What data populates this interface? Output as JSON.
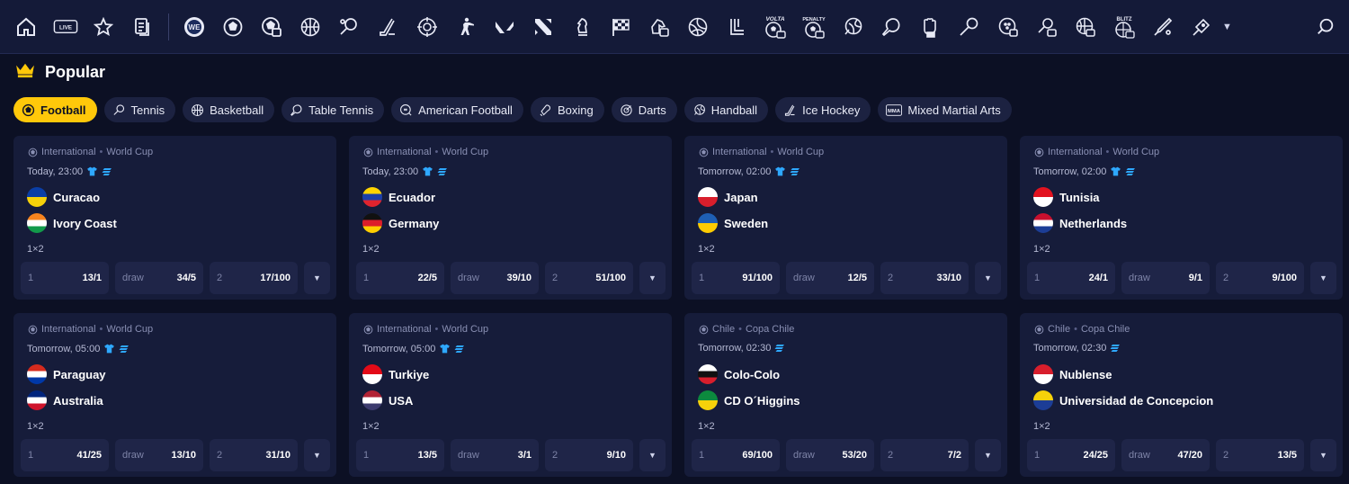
{
  "nav": {
    "icons": [
      "home-icon",
      "live-icon",
      "star-icon",
      "betslip-icon",
      "e-soccer-icon",
      "football-icon",
      "virtual-football-icon",
      "basketball-icon",
      "tennis-icon",
      "ice-hockey-icon",
      "esports-target-icon",
      "counter-strike-icon",
      "valorant-icon",
      "dota-icon",
      "chess-icon",
      "racing-flag-icon",
      "horse-racing-icon",
      "volleyball-icon",
      "table-icon",
      "volta-icon",
      "penalty-icon",
      "handball-icon",
      "table-tennis-icon",
      "boxing-glove-icon",
      "badminton-icon",
      "golf-icon",
      "esports-tennis-icon",
      "e-basketball-icon",
      "blitz-icon",
      "cricket-icon",
      "darts-icon"
    ],
    "live_label": "LIVE",
    "esoccer_label": "WE",
    "volta_label": "VOLTA",
    "penalty_label": "PENALTY",
    "blitz_label": "BLITZ"
  },
  "popular": {
    "title": "Popular"
  },
  "chips": [
    {
      "label": "Football",
      "icon": "football-icon",
      "active": true
    },
    {
      "label": "Tennis",
      "icon": "tennis-icon",
      "active": false
    },
    {
      "label": "Basketball",
      "icon": "basketball-icon",
      "active": false
    },
    {
      "label": "Table Tennis",
      "icon": "table-tennis-icon",
      "active": false
    },
    {
      "label": "American Football",
      "icon": "american-football-icon",
      "active": false
    },
    {
      "label": "Boxing",
      "icon": "boxing-icon",
      "active": false
    },
    {
      "label": "Darts",
      "icon": "darts-icon",
      "active": false
    },
    {
      "label": "Handball",
      "icon": "handball-icon",
      "active": false
    },
    {
      "label": "Ice Hockey",
      "icon": "ice-hockey-icon",
      "active": false
    },
    {
      "label": "Mixed Martial Arts",
      "icon": "mma-icon",
      "active": false
    }
  ],
  "mma_badge": "MMA",
  "odds_labels": {
    "home": "1",
    "draw": "draw",
    "away": "2"
  },
  "matches": [
    {
      "country": "International",
      "league": "World Cup",
      "time": "Today, 23:00",
      "kit": true,
      "stats": true,
      "home": "Curacao",
      "away": "Ivory Coast",
      "market": "1×2",
      "odd1": "13/1",
      "oddx": "34/5",
      "odd2": "17/100",
      "home_colors": [
        "#0a3ea6",
        "#f6d10a"
      ],
      "away_colors": [
        "#f7841e",
        "#ffffff",
        "#129a4a"
      ]
    },
    {
      "country": "International",
      "league": "World Cup",
      "time": "Today, 23:00",
      "kit": true,
      "stats": true,
      "home": "Ecuador",
      "away": "Germany",
      "market": "1×2",
      "odd1": "22/5",
      "oddx": "39/10",
      "odd2": "51/100",
      "home_colors": [
        "#ffd400",
        "#1c3fa8",
        "#e0242e"
      ],
      "away_colors": [
        "#111111",
        "#dd1e2a",
        "#ffce00"
      ]
    },
    {
      "country": "International",
      "league": "World Cup",
      "time": "Tomorrow, 02:00",
      "kit": true,
      "stats": true,
      "home": "Japan",
      "away": "Sweden",
      "market": "1×2",
      "odd1": "91/100",
      "oddx": "12/5",
      "odd2": "33/10",
      "home_colors": [
        "#ffffff",
        "#d81e2c"
      ],
      "away_colors": [
        "#1e5fb4",
        "#fecc02"
      ]
    },
    {
      "country": "International",
      "league": "World Cup",
      "time": "Tomorrow, 02:00",
      "kit": true,
      "stats": true,
      "home": "Tunisia",
      "away": "Netherlands",
      "market": "1×2",
      "odd1": "24/1",
      "oddx": "9/1",
      "odd2": "9/100",
      "home_colors": [
        "#e2121f",
        "#ffffff"
      ],
      "away_colors": [
        "#c8102e",
        "#ffffff",
        "#1c3d96"
      ]
    },
    {
      "country": "International",
      "league": "World Cup",
      "time": "Tomorrow, 05:00",
      "kit": true,
      "stats": true,
      "home": "Paraguay",
      "away": "Australia",
      "market": "1×2",
      "odd1": "41/25",
      "oddx": "13/10",
      "odd2": "31/10",
      "home_colors": [
        "#d52b1e",
        "#ffffff",
        "#0038a8"
      ],
      "away_colors": [
        "#00247d",
        "#ffffff",
        "#cf142b"
      ]
    },
    {
      "country": "International",
      "league": "World Cup",
      "time": "Tomorrow, 05:00",
      "kit": true,
      "stats": true,
      "home": "Turkiye",
      "away": "USA",
      "market": "1×2",
      "odd1": "13/5",
      "oddx": "3/1",
      "odd2": "9/10",
      "home_colors": [
        "#e30a17",
        "#ffffff"
      ],
      "away_colors": [
        "#b22234",
        "#ffffff",
        "#3c3b6e"
      ]
    },
    {
      "country": "Chile",
      "league": "Copa Chile",
      "time": "Tomorrow, 02:30",
      "kit": false,
      "stats": true,
      "home": "Colo-Colo",
      "away": "CD O´Higgins",
      "market": "1×2",
      "odd1": "69/100",
      "oddx": "53/20",
      "odd2": "7/2",
      "home_colors": [
        "#ffffff",
        "#111111",
        "#d81e2c"
      ],
      "away_colors": [
        "#0c8a3e",
        "#f6d10a"
      ]
    },
    {
      "country": "Chile",
      "league": "Copa Chile",
      "time": "Tomorrow, 02:30",
      "kit": false,
      "stats": true,
      "home": "Nublense",
      "away": "Universidad de Concepcion",
      "market": "1×2",
      "odd1": "24/25",
      "oddx": "47/20",
      "odd2": "13/5",
      "home_colors": [
        "#d81e2c",
        "#ffffff"
      ],
      "away_colors": [
        "#f6d10a",
        "#1c3d96"
      ]
    }
  ],
  "colors": {
    "accent": "#ffc80a",
    "live_blue": "#2ea8ff",
    "card_bg": "#161c3a",
    "page_bg": "#0c1024"
  }
}
